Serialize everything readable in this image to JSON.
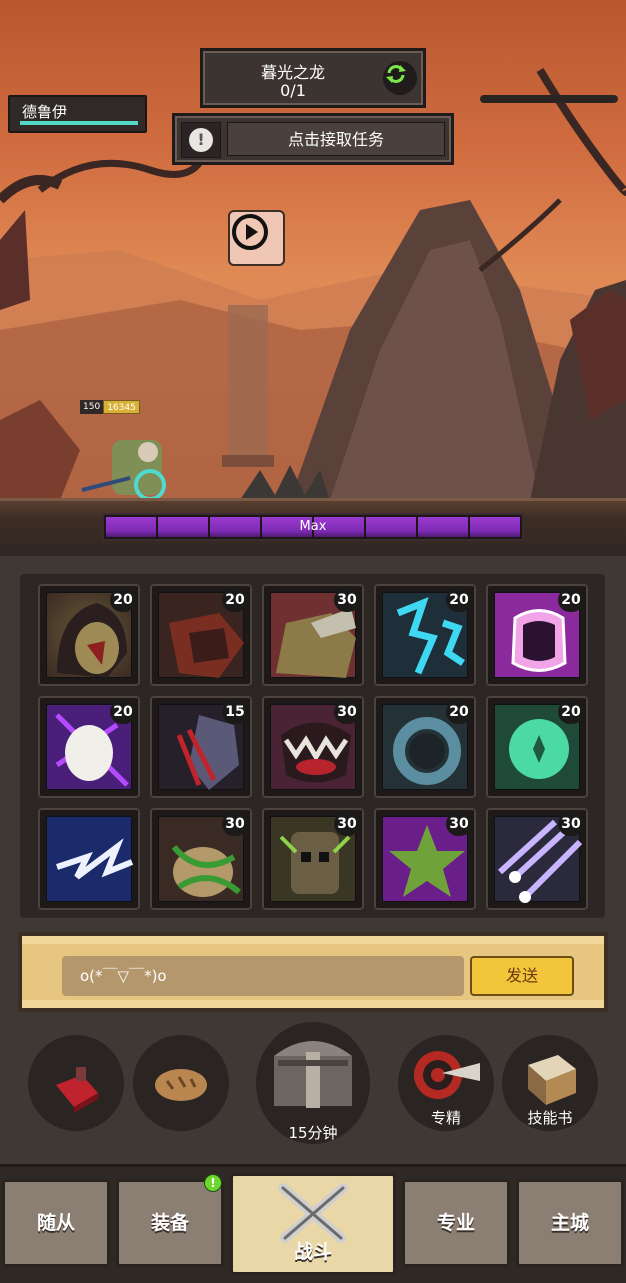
{
  "header": {
    "boss_name": "暮光之龙",
    "boss_progress": "0/1",
    "quest_label": "点击接取任务",
    "quest_icon": "!",
    "player_name": "德鲁伊"
  },
  "hero": {
    "level": "150",
    "hp": "16345"
  },
  "xp_bar": {
    "label": "Max",
    "fill_fraction": 1.0,
    "segments": 8
  },
  "skills": [
    {
      "count": "20",
      "icon": "skull-hood-icon"
    },
    {
      "count": "20",
      "icon": "bear-roar-icon"
    },
    {
      "count": "30",
      "icon": "ogre-charge-icon"
    },
    {
      "count": "20",
      "icon": "lightning-claw-icon"
    },
    {
      "count": "20",
      "icon": "paw-shield-icon"
    },
    {
      "count": "20",
      "icon": "feral-burst-icon"
    },
    {
      "count": "15",
      "icon": "shadow-slash-icon"
    },
    {
      "count": "30",
      "icon": "maw-bite-icon"
    },
    {
      "count": "20",
      "icon": "frost-ring-icon"
    },
    {
      "count": "20",
      "icon": "nature-shield-icon"
    },
    {
      "count": "",
      "icon": "storm-strike-icon"
    },
    {
      "count": "30",
      "icon": "vine-grasp-icon"
    },
    {
      "count": "30",
      "icon": "treant-face-icon"
    },
    {
      "count": "30",
      "icon": "leaf-star-icon"
    },
    {
      "count": "30",
      "icon": "starfall-icon"
    }
  ],
  "chat": {
    "message": "o(*￣▽￣*)o",
    "send_label": "发送"
  },
  "actions": {
    "potion_icon": "potion-icon",
    "bread_icon": "bread-icon",
    "chest_timer": "15分钟",
    "specialize_label": "专精",
    "skillbook_label": "技能书"
  },
  "tabs": [
    {
      "label": "随从"
    },
    {
      "label": "装备",
      "badge": "!"
    },
    {
      "label": "战斗"
    },
    {
      "label": "专业"
    },
    {
      "label": "主城"
    }
  ],
  "colors": {
    "sky": "#d27a4a",
    "xp_purple": "#8a30c2",
    "hp_teal": "#52d6c5",
    "send_yellow": "#f3c53b",
    "active_tab": "#ead7a8"
  }
}
